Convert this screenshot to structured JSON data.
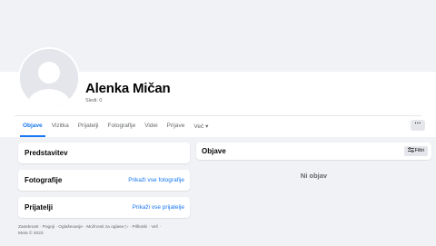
{
  "profile": {
    "name": "Alenka Mičan",
    "followers": "Sledi: 0"
  },
  "tabs": [
    {
      "label": "Objave"
    },
    {
      "label": "Vizitka"
    },
    {
      "label": "Prijatelji"
    },
    {
      "label": "Fotografije"
    },
    {
      "label": "Videi"
    },
    {
      "label": "Prijave"
    },
    {
      "label": "Več ▾"
    }
  ],
  "more_button": "···",
  "intro": {
    "title": "Predstavitev"
  },
  "photos": {
    "title": "Fotografije",
    "link": "Prikaži vse fotografije"
  },
  "friends": {
    "title": "Prijatelji",
    "link": "Prikaži vse prijatelje"
  },
  "footer": {
    "text": "Zasebnost · Pogoji · Oglaševanje · Možnosti za oglase ▷ · Piškotki · Več ·",
    "copyright": "Meta © 2023"
  },
  "posts": {
    "title": "Objave",
    "filter_label": "Filtri",
    "empty_text": "Ni objav"
  },
  "colors": {
    "accent": "#1877f2",
    "background": "#f0f2f5",
    "secondary_text": "#65676b"
  },
  "icons": {
    "avatar": "default-avatar-icon",
    "filter": "filter-sliders-icon"
  }
}
